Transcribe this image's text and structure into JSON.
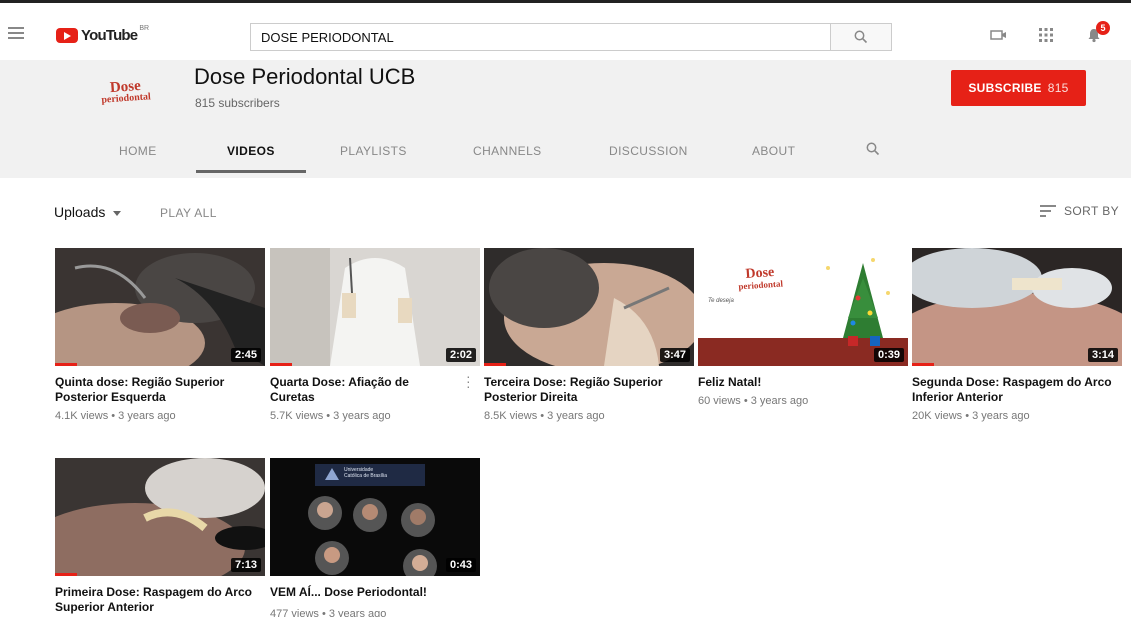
{
  "header": {
    "logo_text": "YouTube",
    "logo_sup": "BR",
    "search_value": "DOSE PERIODONTAL",
    "notification_count": "5"
  },
  "channel": {
    "avatar_text_line1": "Dose",
    "avatar_text_line2": "periodontal",
    "name": "Dose Periodontal UCB",
    "subscribers": "815 subscribers",
    "subscribe_label": "SUBSCRIBE",
    "subscribe_count": "815"
  },
  "tabs": [
    {
      "label": "HOME"
    },
    {
      "label": "VIDEOS"
    },
    {
      "label": "PLAYLISTS"
    },
    {
      "label": "CHANNELS"
    },
    {
      "label": "DISCUSSION"
    },
    {
      "label": "ABOUT"
    }
  ],
  "toolbar": {
    "uploads_label": "Uploads",
    "play_all_label": "PLAY ALL",
    "sort_label": "SORT BY"
  },
  "videos": [
    {
      "title": "Quinta dose: Região Superior Posterior Esquerda",
      "meta": "4.1K views • 3 years ago",
      "duration": "2:45"
    },
    {
      "title": "Quarta Dose: Afiação de Curetas",
      "meta": "5.7K views • 3 years ago",
      "duration": "2:02"
    },
    {
      "title": "Terceira Dose: Região Superior Posterior Direita",
      "meta": "8.5K views • 3 years ago",
      "duration": "3:47"
    },
    {
      "title": "Feliz Natal!",
      "meta": "60 views • 3 years ago",
      "duration": "0:39"
    },
    {
      "title": "Segunda Dose: Raspagem do Arco Inferior Anterior",
      "meta": "20K views • 3 years ago",
      "duration": "3:14"
    },
    {
      "title": "Primeira Dose: Raspagem do Arco Superior Anterior",
      "meta": "",
      "duration": "7:13"
    },
    {
      "title": "VEM AÍ... Dose Periodontal!",
      "meta": "477 views • 3 years ago",
      "duration": "0:43"
    }
  ],
  "thumb_card_text": {
    "christmas_logo_line1": "Dose",
    "christmas_logo_line2": "periodontal",
    "christmas_sub": "Te deseja",
    "ucb_line1": "Universidade",
    "ucb_line2": "Católica de Brasília"
  },
  "colors": {
    "brand_red": "#e62117",
    "header_bg": "#f1f1f1"
  }
}
